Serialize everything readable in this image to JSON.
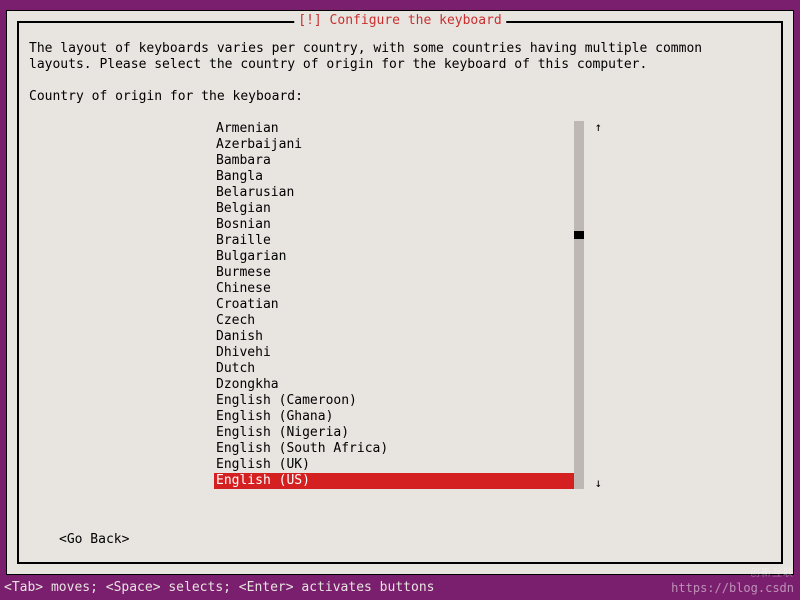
{
  "dialog": {
    "title": "[!] Configure the keyboard",
    "instructions": "The layout of keyboards varies per country, with some countries having multiple common\nlayouts. Please select the country of origin for the keyboard of this computer.",
    "prompt": "Country of origin for the keyboard:",
    "go_back": "<Go Back>"
  },
  "list": {
    "items": [
      "Armenian",
      "Azerbaijani",
      "Bambara",
      "Bangla",
      "Belarusian",
      "Belgian",
      "Bosnian",
      "Braille",
      "Bulgarian",
      "Burmese",
      "Chinese",
      "Croatian",
      "Czech",
      "Danish",
      "Dhivehi",
      "Dutch",
      "Dzongkha",
      "English (Cameroon)",
      "English (Ghana)",
      "English (Nigeria)",
      "English (South Africa)",
      "English (UK)",
      "English (US)"
    ],
    "selected_index": 22
  },
  "help_bar": "<Tab> moves; <Space> selects; <Enter> activates buttons",
  "watermark_url": "https://blog.csdn",
  "watermark_logo": "创新互联"
}
